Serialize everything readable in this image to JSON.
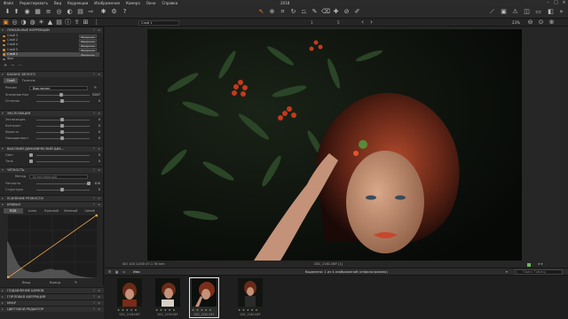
{
  "menubar": {
    "items": [
      "Файл",
      "Редактировать",
      "Вид",
      "Коррекции",
      "Изображение",
      "Камера",
      "Окно",
      "Справка"
    ],
    "title": "2018"
  },
  "subbar": {
    "layer_select": "Слой 1",
    "zoom": "23%",
    "counter": "1",
    "extra": "5"
  },
  "layers": {
    "header": "ЛОКАЛЬНЫЕ КОРРЕКЦИИ",
    "items": [
      {
        "name": "Слой 3",
        "tag": "Введение"
      },
      {
        "name": "Слой 2",
        "tag": "Введение"
      },
      {
        "name": "Слой 4",
        "tag": "Введение"
      },
      {
        "name": "Слой 5",
        "tag": "Введение"
      },
      {
        "name": "Слой 1",
        "tag": "Введение"
      },
      {
        "name": "Фон",
        "tag": ""
      }
    ]
  },
  "white_balance": {
    "header": "БАЛАНС БЕЛОГО",
    "tabs": [
      "Слой",
      "Точечно"
    ],
    "mode_label": "Режим",
    "mode_value": "Выключен",
    "kelvin_label": "Значение Кел",
    "kelvin_value": "5287",
    "tint_label": "Оттенок",
    "tint_value": "0"
  },
  "exposure": {
    "header": "ЭКСПОЗИЦИЯ",
    "rows": [
      {
        "label": "Экспозиция",
        "value": "0"
      },
      {
        "label": "Контраст",
        "value": "0"
      },
      {
        "label": "Яркость",
        "value": "0"
      },
      {
        "label": "Насыщенност",
        "value": "0"
      }
    ]
  },
  "hdr": {
    "header": "ВЫСОКИЙ ДИНАМИЧЕСКИЙ ДИА...",
    "rows": [
      {
        "label": "Свет",
        "value": "0"
      },
      {
        "label": "Тень",
        "value": "0"
      }
    ]
  },
  "clarity": {
    "header": "ЧЁТКОСТЬ",
    "method_label": "Метод",
    "method_value": "Естественный",
    "rows": [
      {
        "label": "Четкость",
        "value": "100"
      },
      {
        "label": "Структура",
        "value": "0"
      }
    ]
  },
  "sharpening": {
    "header": "УСИЛЕНИЕ РЕЗКОСТИ"
  },
  "curve": {
    "header": "КРИВАЯ",
    "tabs": [
      "RGB",
      "Luma",
      "Красный",
      "Зеленый",
      "Синий"
    ],
    "input_label": "Ввод",
    "output_label": "Вывод",
    "input_value": "0",
    "output_value": "0"
  },
  "bottom_sections": [
    "ПОДАВЛЕНИЕ ШУМОВ",
    "ГОРЛОВАЯ АБЕРРАЦИЯ",
    "МУАР",
    "ЦВЕТОВОЙ РЕДАКТОР"
  ],
  "viewer": {
    "caption": "ISO 100 1/200 f/7.1 78 mm",
    "filename": "DSC_2181.NEF [1]"
  },
  "browser_bar": {
    "label": "Имя",
    "status": "Выделено: 1 из 4 изображений (отфильтровано)",
    "search_placeholder": "Поиск Таблиц"
  },
  "thumbnails": [
    {
      "name": "DSC_2138.NEF",
      "stars": "★ ★ ★ ★ ★"
    },
    {
      "name": "DSC_2139.NEF",
      "stars": "★ ★ ★ ★ ★"
    },
    {
      "name": "DSC_2181.NEF",
      "stars": "★ ★ ★ ★ ★"
    },
    {
      "name": "DSC_2182.NEF",
      "stars": "★ ★ ★ ★ ★"
    }
  ]
}
